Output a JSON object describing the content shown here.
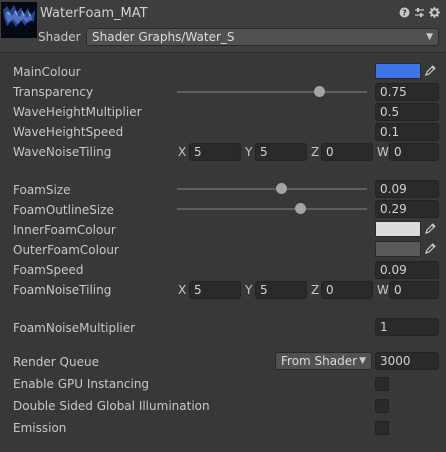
{
  "header": {
    "material_name": "WaterFoam_MAT",
    "shader_label": "Shader",
    "shader_value": "Shader Graphs/Water_S",
    "icons": [
      "help-icon",
      "preset-icon",
      "settings-icon"
    ]
  },
  "properties": {
    "main_colour": {
      "label": "MainColour",
      "color": "#3f74e6"
    },
    "transparency": {
      "label": "Transparency",
      "value": "0.75",
      "level": 0.75
    },
    "wave_height_multiplier": {
      "label": "WaveHeightMultiplier",
      "value": "0.5"
    },
    "wave_height_speed": {
      "label": "WaveHeightSpeed",
      "value": "0.1"
    },
    "wave_noise_tiling": {
      "label": "WaveNoiseTiling",
      "x": "5",
      "y": "5",
      "z": "0",
      "w": "0"
    },
    "foam_size": {
      "label": "FoamSize",
      "value": "0.09",
      "level": 0.55
    },
    "foam_outline_size": {
      "label": "FoamOutlineSize",
      "value": "0.29",
      "level": 0.65
    },
    "inner_foam_colour": {
      "label": "InnerFoamColour",
      "color": "#dcdcdc"
    },
    "outer_foam_colour": {
      "label": "OuterFoamColour",
      "color": "#5a5a5a"
    },
    "foam_speed": {
      "label": "FoamSpeed",
      "value": "0.09"
    },
    "foam_noise_tiling": {
      "label": "FoamNoiseTiling",
      "x": "5",
      "y": "5",
      "z": "0",
      "w": "0"
    },
    "foam_noise_multiplier": {
      "label": "FoamNoiseMultiplier",
      "value": "1"
    }
  },
  "vector_axes": {
    "x": "X",
    "y": "Y",
    "z": "Z",
    "w": "W"
  },
  "advanced": {
    "render_queue": {
      "label": "Render Queue",
      "mode": "From Shader",
      "value": "3000"
    },
    "gpu_instancing": {
      "label": "Enable GPU Instancing",
      "checked": false
    },
    "double_sided_gi": {
      "label": "Double Sided Global Illumination",
      "checked": false
    },
    "emission": {
      "label": "Emission",
      "checked": false
    }
  }
}
